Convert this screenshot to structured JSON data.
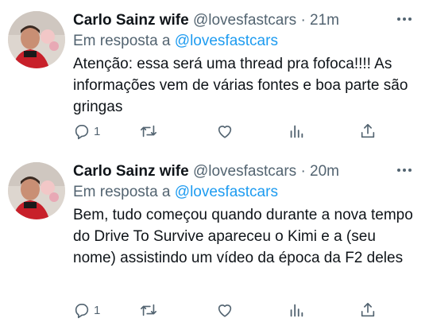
{
  "tweets": [
    {
      "name": "Carlo Sainz wife",
      "handle": "@lovesfastcars",
      "separator": "·",
      "time": "21m",
      "reply_prefix": "Em resposta a",
      "reply_handle": "@lovesfastcars",
      "text": "Atenção: essa será uma thread pra fofoca!!!! As informações vem de várias fontes e boa parte são gringas",
      "reply_count": "1"
    },
    {
      "name": "Carlo Sainz wife",
      "handle": "@lovesfastcars",
      "separator": "·",
      "time": "20m",
      "reply_prefix": "Em resposta a",
      "reply_handle": "@lovesfastcars",
      "text": "Bem, tudo começou quando durante a nova tempo do Drive To Survive apareceu o Kimi e a (seu nome) assistindo um vídeo da época da F2 deles",
      "reply_count": "1"
    }
  ],
  "icons": {
    "reply": "comment-icon",
    "retweet": "retweet-icon",
    "like": "heart-icon",
    "stats": "analytics-icon",
    "share": "share-icon",
    "more": "more-icon"
  },
  "colors": {
    "mention": "#1d9bf0",
    "muted": "#536471",
    "text": "#0f1419"
  }
}
